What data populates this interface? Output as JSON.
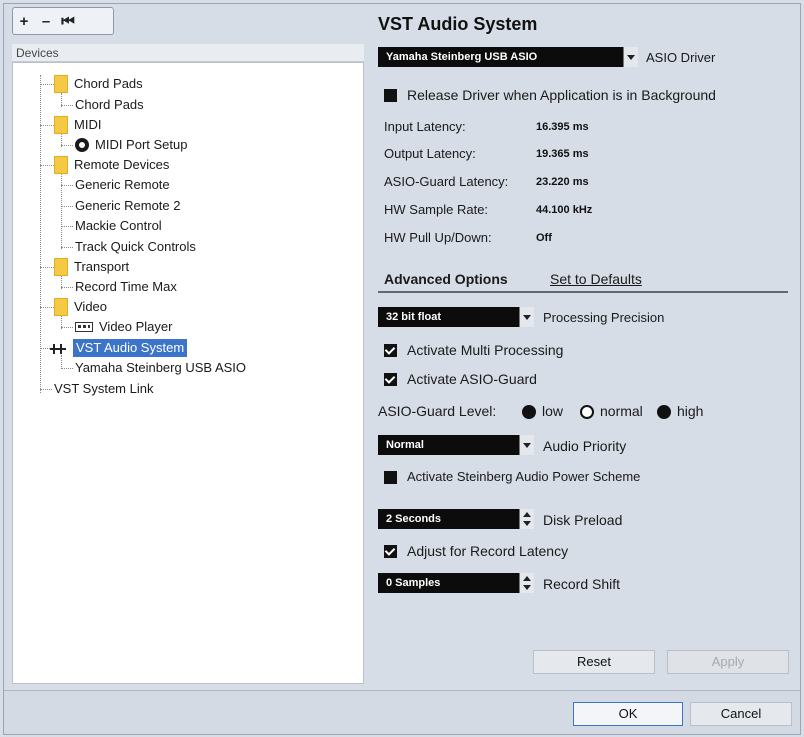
{
  "toolbar": {
    "add": "+",
    "remove": "–",
    "reset": "⏮"
  },
  "devices_header": "Devices",
  "tree": {
    "chord_pads_folder": "Chord Pads",
    "chord_pads": "Chord Pads",
    "midi_folder": "MIDI",
    "midi_port_setup": "MIDI Port Setup",
    "remote_devices_folder": "Remote Devices",
    "generic_remote": "Generic Remote",
    "generic_remote_2": "Generic Remote 2",
    "mackie_control": "Mackie Control",
    "track_quick_controls": "Track Quick Controls",
    "transport_folder": "Transport",
    "record_time_max": "Record Time Max",
    "video_folder": "Video",
    "video_player": "Video Player",
    "vst_audio_system": "VST Audio System",
    "yamaha_usb_asio": "Yamaha Steinberg USB ASIO",
    "vst_system_link": "VST System Link"
  },
  "panel": {
    "title": "VST Audio System",
    "asio_driver_value": "Yamaha Steinberg USB ASIO",
    "asio_driver_label": "ASIO Driver",
    "release_driver_label": "Release Driver when Application is in Background",
    "input_latency_label": "Input Latency:",
    "input_latency_value": "16.395 ms",
    "output_latency_label": "Output Latency:",
    "output_latency_value": "19.365 ms",
    "asio_guard_latency_label": "ASIO-Guard Latency:",
    "asio_guard_latency_value": "23.220 ms",
    "hw_sample_rate_label": "HW Sample Rate:",
    "hw_sample_rate_value": "44.100 kHz",
    "hw_pull_label": "HW Pull Up/Down:",
    "hw_pull_value": "Off",
    "advanced_options": "Advanced Options",
    "set_to_defaults": "Set to Defaults",
    "processing_precision_value": "32 bit float",
    "processing_precision_label": "Processing Precision",
    "activate_multi_processing": "Activate Multi Processing",
    "activate_asio_guard": "Activate ASIO-Guard",
    "asio_guard_level_label": "ASIO-Guard Level:",
    "level_low": "low",
    "level_normal": "normal",
    "level_high": "high",
    "audio_priority_value": "Normal",
    "audio_priority_label": "Audio Priority",
    "power_scheme_label": "Activate Steinberg Audio Power Scheme",
    "disk_preload_value": "2 Seconds",
    "disk_preload_label": "Disk Preload",
    "adjust_record_latency": "Adjust for Record Latency",
    "record_shift_value": "0 Samples",
    "record_shift_label": "Record Shift",
    "reset_button": "Reset",
    "apply_button": "Apply"
  },
  "footer": {
    "ok_button": "OK",
    "cancel_button": "Cancel"
  }
}
